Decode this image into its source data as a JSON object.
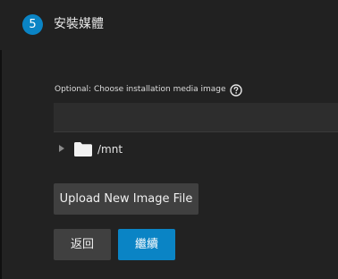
{
  "step": {
    "number": "5",
    "title": "安裝媒體"
  },
  "media_field": {
    "label": "Optional: Choose installation media image",
    "help_icon": "help-circle-icon",
    "value": "",
    "tree": {
      "expand_icon": "chevron-right-icon",
      "folder_icon": "folder-icon",
      "label": "/mnt"
    }
  },
  "buttons": {
    "upload": "Upload New Image File",
    "back": "返回",
    "next": "繼續"
  },
  "colors": {
    "accent": "#0a84c5",
    "background": "#161616",
    "panel": "#222222",
    "button": "#404040"
  }
}
